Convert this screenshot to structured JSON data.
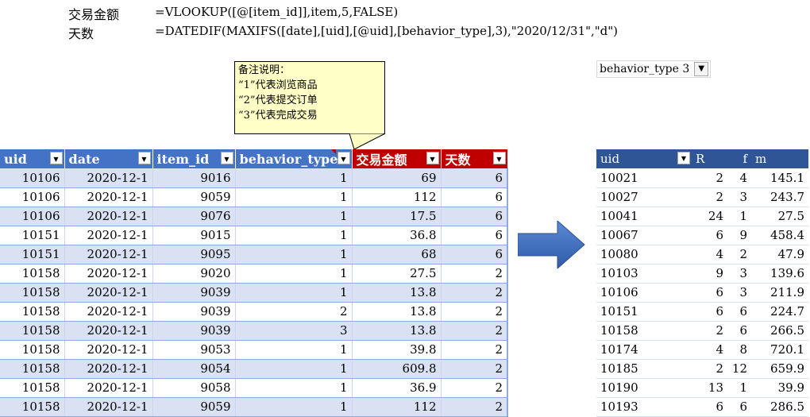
{
  "formulas": [
    {
      "label": "交易金额",
      "expr": "=VLOOKUP([@[item_id]],item,5,FALSE)"
    },
    {
      "label": "天数",
      "expr": "=DATEDIF(MAXIFS([date],[uid],[@uid],[behavior_type],3),\"2020/12/31\",\"d\")"
    }
  ],
  "note": {
    "lines": [
      "备注说明：",
      "“1”代表浏览商品",
      "“2”代表提交订单",
      "“3”代表完成交易"
    ]
  },
  "filter": {
    "label": "behavior_type 3",
    "icon": "filter-icon"
  },
  "table1": {
    "headers": [
      "uid",
      "date",
      "item_id",
      "behavior_type",
      "交易金额",
      "天数"
    ],
    "rows": [
      [
        "10106",
        "2020-12-1",
        "9016",
        "1",
        "69",
        "6"
      ],
      [
        "10106",
        "2020-12-1",
        "9059",
        "1",
        "112",
        "6"
      ],
      [
        "10106",
        "2020-12-1",
        "9076",
        "1",
        "17.5",
        "6"
      ],
      [
        "10151",
        "2020-12-1",
        "9015",
        "1",
        "36.8",
        "6"
      ],
      [
        "10151",
        "2020-12-1",
        "9095",
        "1",
        "68",
        "6"
      ],
      [
        "10158",
        "2020-12-1",
        "9020",
        "1",
        "27.5",
        "2"
      ],
      [
        "10158",
        "2020-12-1",
        "9039",
        "1",
        "13.8",
        "2"
      ],
      [
        "10158",
        "2020-12-1",
        "9039",
        "2",
        "13.8",
        "2"
      ],
      [
        "10158",
        "2020-12-1",
        "9039",
        "3",
        "13.8",
        "2"
      ],
      [
        "10158",
        "2020-12-1",
        "9053",
        "1",
        "39.8",
        "2"
      ],
      [
        "10158",
        "2020-12-1",
        "9054",
        "1",
        "609.8",
        "2"
      ],
      [
        "10158",
        "2020-12-1",
        "9058",
        "1",
        "36.9",
        "2"
      ],
      [
        "10158",
        "2020-12-1",
        "9059",
        "1",
        "112",
        "2"
      ]
    ]
  },
  "table2": {
    "headers": [
      "uid",
      "R",
      "f",
      "m"
    ],
    "rows": [
      [
        "10021",
        "2",
        "4",
        "145.1"
      ],
      [
        "10027",
        "2",
        "3",
        "243.7"
      ],
      [
        "10041",
        "24",
        "1",
        "27.5"
      ],
      [
        "10067",
        "6",
        "9",
        "458.4"
      ],
      [
        "10080",
        "4",
        "2",
        "47.9"
      ],
      [
        "10103",
        "9",
        "3",
        "139.6"
      ],
      [
        "10106",
        "6",
        "3",
        "211.9"
      ],
      [
        "10151",
        "6",
        "6",
        "224.7"
      ],
      [
        "10158",
        "2",
        "6",
        "266.5"
      ],
      [
        "10174",
        "4",
        "8",
        "720.1"
      ],
      [
        "10185",
        "2",
        "12",
        "659.9"
      ],
      [
        "10190",
        "13",
        "1",
        "39.9"
      ],
      [
        "10193",
        "6",
        "6",
        "286.5"
      ]
    ]
  },
  "colors": {
    "header_blue": "#4472c4",
    "header_red": "#c00000",
    "band": "#d9e1f2",
    "arrow": "#4472c4"
  }
}
